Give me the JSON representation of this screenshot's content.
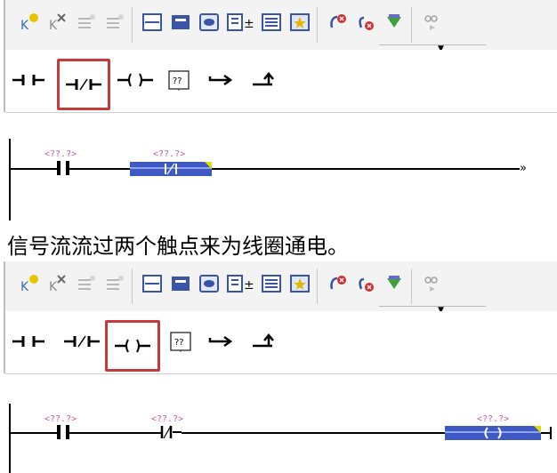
{
  "toolbar_icons": [
    "insert-network-icon",
    "delete-network-icon",
    "insert-row-icon",
    "insert-column-icon",
    "ladder-view-icon",
    "fbd-view-icon",
    "comment-icon",
    "address-expand-icon",
    "symbol-table-icon",
    "favorite-icon",
    "go-online-icon",
    "go-offline-icon",
    "download-icon",
    "monitor-icon"
  ],
  "instructions": [
    {
      "name": "normally-open-contact",
      "glyph": "⊣⊢"
    },
    {
      "name": "normally-closed-contact",
      "glyph": "⊣/⊢"
    },
    {
      "name": "coil",
      "glyph": "—()—"
    },
    {
      "name": "empty-box",
      "glyph": "??"
    },
    {
      "name": "open-branch",
      "glyph": "↦"
    },
    {
      "name": "close-branch",
      "glyph": "⬏"
    }
  ],
  "top": {
    "selected": "normally-closed-contact",
    "tag1": "<??.?>",
    "tag2": "<??.?>"
  },
  "caption": "信号流流过两个触点来为线圈通电。",
  "bottom": {
    "selected": "coil",
    "tag1": "<??.?>",
    "tag2": "<??.?>",
    "tag3": "<??.?>"
  }
}
